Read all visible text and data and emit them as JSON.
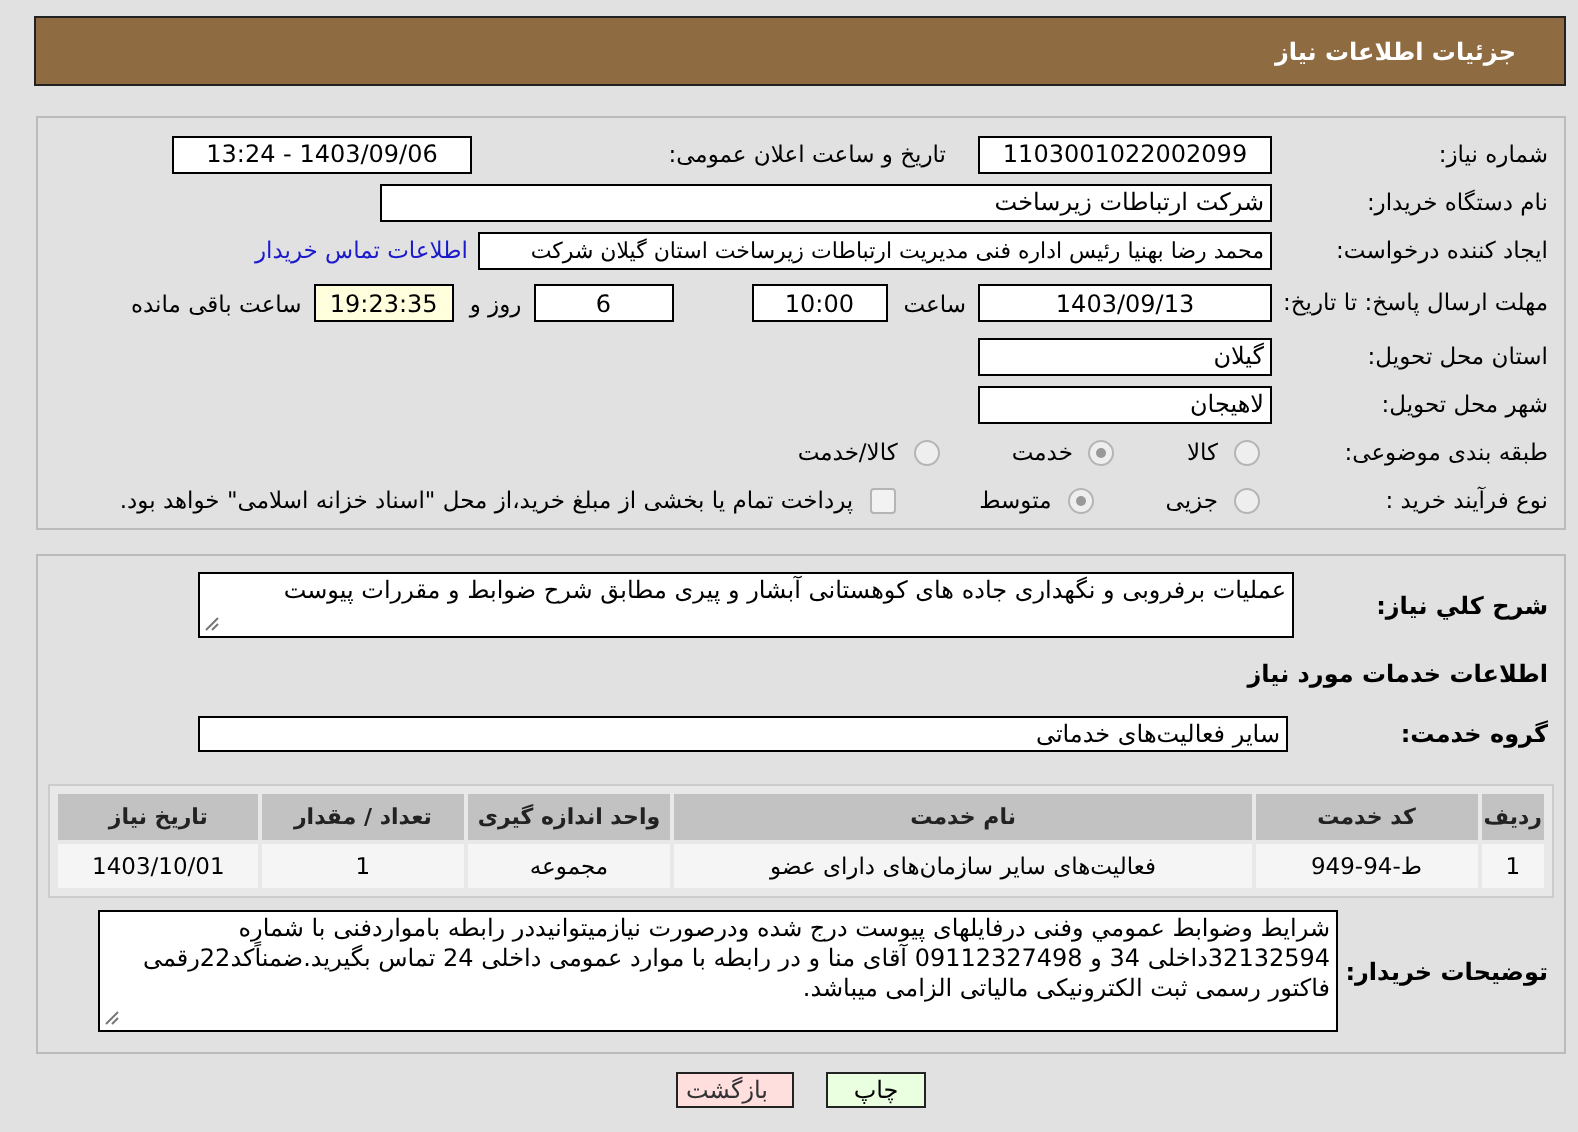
{
  "header": {
    "title": "جزئیات اطلاعات نیاز"
  },
  "details": {
    "need_number": {
      "label": "شماره نیاز:",
      "value": "1103001022002099"
    },
    "announce": {
      "label": "تاریخ و ساعت اعلان عمومی:",
      "value": "1403/09/06 - 13:24"
    },
    "buyer": {
      "label": "نام دستگاه خریدار:",
      "value": "شرکت ارتباطات زیرساخت"
    },
    "creator": {
      "label": "ایجاد کننده درخواست:",
      "value": "محمد رضا بهنیا رئیس اداره فنی مدیریت ارتباطات زیرساخت استان گیلان شرکت",
      "link": "اطلاعات تماس خریدار"
    },
    "deadline": {
      "label": "مهلت ارسال پاسخ: تا تاریخ:",
      "date": "1403/09/13",
      "time_label": "ساعت",
      "time": "10:00",
      "days": "6",
      "days_label": "روز و",
      "remaining": "19:23:35",
      "remaining_label": "ساعت باقی مانده"
    },
    "province": {
      "label": "استان محل تحویل:",
      "value": "گیلان"
    },
    "city": {
      "label": "شهر محل تحویل:",
      "value": "لاهیجان"
    },
    "category": {
      "label": "طبقه بندی موضوعی:",
      "options": [
        {
          "label": "کالا",
          "selected": false
        },
        {
          "label": "خدمت",
          "selected": true
        },
        {
          "label": "کالا/خدمت",
          "selected": false
        }
      ]
    },
    "process": {
      "label": "نوع فرآیند خرید :",
      "options": [
        {
          "label": "جزیی",
          "selected": false
        },
        {
          "label": "متوسط",
          "selected": true
        }
      ],
      "payment": {
        "checked": false,
        "text": "پرداخت تمام یا بخشی از مبلغ خرید،از محل \"اسناد خزانه اسلامی\" خواهد بود."
      }
    }
  },
  "description": {
    "label": "شرح کلي نیاز:",
    "value": "عملیات برفروبی و نگهداری جاده های کوهستانی آبشار و پیری مطابق شرح ضوابط و مقررات پیوست"
  },
  "services_heading": "اطلاعات خدمات مورد نیاز",
  "service_group": {
    "label": "گروه خدمت:",
    "value": "سایر فعالیت‌های خدماتی"
  },
  "table": {
    "columns": [
      "ردیف",
      "کد خدمت",
      "نام خدمت",
      "واحد اندازه گیری",
      "تعداد / مقدار",
      "تاریخ نیاز"
    ],
    "rows": [
      [
        "1",
        "ط-94-949",
        "فعالیت‌های سایر سازمان‌های دارای عضو",
        "مجموعه",
        "1",
        "1403/10/01"
      ]
    ]
  },
  "buyer_notes": {
    "label": "توضیحات خریدار:",
    "value": "شرایط وضوابط عمومي وفنی درفایلهای پیوست درج شده ودرصورت نیازمیتوانیددر رابطه بامواردفنی با شماره 32132594داخلی 34 و 09112327498 آقای منا و در رابطه با موارد عمومی داخلی 24 تماس  بگیرید.ضمناًکد22رقمی فاکتور رسمی ثبت الکترونیکی مالیاتی الزامی میباشد."
  },
  "buttons": [
    {
      "label": "چاپ",
      "kind": "print"
    },
    {
      "label": "بازگشت",
      "kind": "back"
    }
  ]
}
